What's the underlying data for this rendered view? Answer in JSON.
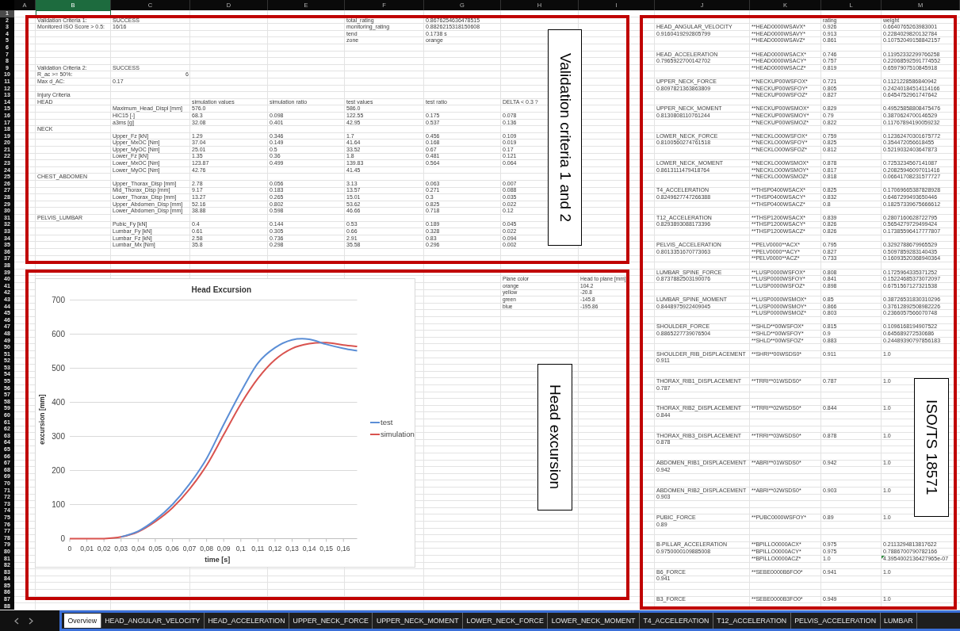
{
  "columns": [
    {
      "label": "A",
      "selected": false
    },
    {
      "label": "B",
      "selected": true
    },
    {
      "label": "C",
      "selected": false
    },
    {
      "label": "D",
      "selected": false
    },
    {
      "label": "E",
      "selected": false
    },
    {
      "label": "F",
      "selected": false
    },
    {
      "label": "G",
      "selected": false
    },
    {
      "label": "H",
      "selected": false
    },
    {
      "label": "I",
      "selected": false
    },
    {
      "label": "J",
      "selected": false
    },
    {
      "label": "K",
      "selected": false
    },
    {
      "label": "L",
      "selected": false
    },
    {
      "label": "M",
      "selected": false
    }
  ],
  "rows": [
    {
      "number": "1",
      "selected": true
    },
    {
      "number": "2",
      "selected": false,
      "cells": [
        null,
        "Validation Criteria 1:",
        "SUCCESS",
        null,
        null,
        "total_rating",
        "0.8676254636478515",
        null,
        null,
        null,
        null,
        "rating",
        "weight"
      ]
    },
    {
      "number": "3",
      "selected": false,
      "cells": [
        null,
        "Monitored ISO Score > 0.5:",
        "16/16",
        null,
        null,
        "monitoring_rating",
        "0.8826215318150608",
        null,
        null,
        "HEAD_ANGULAR_VELOCITY",
        "**HEAD0000WSAVX*",
        "0.926",
        "0.6640765263983001"
      ]
    },
    {
      "number": "4",
      "selected": false,
      "cells": [
        null,
        null,
        null,
        null,
        null,
        "tend",
        "0.1738 s",
        null,
        null,
        "0.9160419292805799",
        "**HEAD0000WSAVY*",
        "0.913",
        "0.2284029820132784"
      ]
    },
    {
      "number": "5",
      "selected": false,
      "cells": [
        null,
        null,
        null,
        null,
        null,
        "zone",
        "orange",
        null,
        null,
        null,
        "**HEAD0000WSAVZ*",
        "0.861",
        "0.10752049158842157"
      ]
    },
    {
      "number": "6",
      "selected": false
    },
    {
      "number": "7",
      "selected": false,
      "cells": [
        null,
        null,
        null,
        null,
        null,
        null,
        null,
        null,
        null,
        "HEAD_ACCELERATION",
        "**HEAD0000WSACX*",
        "0.746",
        "0.11952332299766258"
      ]
    },
    {
      "number": "8",
      "selected": false,
      "cells": [
        null,
        null,
        null,
        null,
        null,
        null,
        null,
        null,
        null,
        "0.7965922700142702",
        "**HEAD0000WSACY*",
        "0.757",
        "0.22068592591774552"
      ]
    },
    {
      "number": "9",
      "selected": false,
      "cells": [
        null,
        "Validation Criteria 2:",
        "SUCCESS",
        null,
        null,
        null,
        null,
        null,
        null,
        null,
        "**HEAD0000WSACZ*",
        "0.819",
        "0.6597907510845918"
      ]
    },
    {
      "number": "10",
      "selected": false,
      "cells": [
        null,
        "R_ac >= 50%:",
        {
          "text": "6",
          "kind": "number"
        }
      ]
    },
    {
      "number": "11",
      "selected": false,
      "cells": [
        null,
        "Max d_AC:",
        "0.17",
        null,
        null,
        null,
        null,
        null,
        null,
        "UPPER_NECK_FORCE",
        "**NECKUP00WSFOX*",
        "0.721",
        "0.1121228586840942"
      ]
    },
    {
      "number": "12",
      "selected": false,
      "cells": [
        null,
        null,
        null,
        null,
        null,
        null,
        null,
        null,
        null,
        "0.8097821363863809",
        "**NECKUP00WSFOY*",
        "0.805",
        "0.24240184514114166"
      ]
    },
    {
      "number": "13",
      "selected": false,
      "cells": [
        null,
        "Injury Criteria",
        null,
        null,
        null,
        null,
        null,
        null,
        null,
        null,
        "**NECKUP00WSFOZ*",
        "0.827",
        "0.6454752961747642"
      ]
    },
    {
      "number": "14",
      "selected": false,
      "cells": [
        null,
        "HEAD",
        null,
        "simulation values",
        "simulation ratio",
        "test values",
        "test ratio",
        "DELTA < 0.3 ?"
      ]
    },
    {
      "number": "15",
      "selected": false,
      "cells": [
        null,
        null,
        "Maximum_Head_Displ [mm]",
        "576.0",
        null,
        "586.0",
        null,
        null,
        null,
        "UPPER_NECK_MOMENT",
        "**NECKUP00WSMOX*",
        "0.829",
        "0.49525858808475476"
      ]
    },
    {
      "number": "16",
      "selected": false,
      "cells": [
        null,
        null,
        "HIC15 [-]",
        "68.3",
        "0.098",
        "122.55",
        "0.175",
        "0.078",
        null,
        "0.8130808110761244",
        "**NECKUP00WSMOY*",
        "0.79",
        "0.3870624700146529"
      ]
    },
    {
      "number": "17",
      "selected": false,
      "cells": [
        null,
        null,
        "a3ms [g]",
        "32.08",
        "0.401",
        "42.95",
        "0.537",
        "0.136",
        null,
        null,
        "**NECKUP00WSMOZ*",
        "0.822",
        "0.11767894190059232"
      ]
    },
    {
      "number": "18",
      "selected": false,
      "cells": [
        null,
        "NECK"
      ]
    },
    {
      "number": "19",
      "selected": false,
      "cells": [
        null,
        null,
        "Upper_Fz [kN]",
        "1.29",
        "0.346",
        "1.7",
        "0.456",
        "0.109",
        null,
        "LOWER_NECK_FORCE",
        "**NECKLO00WSFOX*",
        "0.759",
        "0.12362470301675772"
      ]
    },
    {
      "number": "20",
      "selected": false,
      "cells": [
        null,
        null,
        "Upper_MxOC [Nm]",
        "37.04",
        "0.149",
        "41.64",
        "0.168",
        "0.019",
        null,
        "0.8100560274761518",
        "**NECKLO00WSFOY*",
        "0.825",
        "0.354472056618455"
      ]
    },
    {
      "number": "21",
      "selected": false,
      "cells": [
        null,
        null,
        "Upper_MyOC [Nm]",
        "25.01",
        "0.5",
        "33.52",
        "0.67",
        "0.17",
        null,
        null,
        "**NECKLO00WSFOZ*",
        "0.812",
        "0.5219032403647873"
      ]
    },
    {
      "number": "22",
      "selected": false,
      "cells": [
        null,
        null,
        "Lower_Fz [kN]",
        "1.35",
        "0.36",
        "1.8",
        "0.481",
        "0.121"
      ]
    },
    {
      "number": "23",
      "selected": false,
      "cells": [
        null,
        null,
        "Lower_MxOC [Nm]",
        "123.87",
        "0.499",
        "139.83",
        "0.564",
        "0.064",
        null,
        "LOWER_NECK_MOMENT",
        "**NECKLO00WSMOX*",
        "0.878",
        "0.7253234567141087"
      ]
    },
    {
      "number": "24",
      "selected": false,
      "cells": [
        null,
        null,
        "Lower_MyOC [Nm]",
        "42.76",
        null,
        "41.45",
        null,
        null,
        null,
        "0.8613111479418764",
        "**NECKLO00WSMOY*",
        "0.817",
        "0.20825946097011416"
      ]
    },
    {
      "number": "25",
      "selected": false,
      "cells": [
        null,
        "CHEST_ABDOMEN",
        null,
        null,
        null,
        null,
        null,
        null,
        null,
        null,
        "**NECKLO00WSMOZ*",
        "0.818",
        "0.06641708231577727"
      ]
    },
    {
      "number": "26",
      "selected": false,
      "cells": [
        null,
        null,
        "Upper_Thorax_Disp [mm]",
        "2.78",
        "0.056",
        "3.13",
        "0.063",
        "0.007"
      ]
    },
    {
      "number": "27",
      "selected": false,
      "cells": [
        null,
        null,
        "Mid_Thorax_Disp [mm]",
        "9.17",
        "0.183",
        "13.57",
        "0.271",
        "0.088",
        null,
        "T4_ACCELERATION",
        "**THSP0400WSACX*",
        "0.825",
        "0.17069665387828928"
      ]
    },
    {
      "number": "28",
      "selected": false,
      "cells": [
        null,
        null,
        "Lower_Thorax_Disp [mm]",
        "13.27",
        "0.265",
        "15.01",
        "0.3",
        "0.035",
        null,
        "0.8249627747266388",
        "**THSP0400WSACY*",
        "0.832",
        "0.6467299493650446"
      ]
    },
    {
      "number": "29",
      "selected": false,
      "cells": [
        null,
        null,
        "Upper_Abdomen_Disp [mm]",
        "52.16",
        "0.802",
        "53.62",
        "0.825",
        "0.022",
        null,
        null,
        "**THSP0400WSACZ*",
        "0.8",
        "0.18257339675666612"
      ]
    },
    {
      "number": "30",
      "selected": false,
      "cells": [
        null,
        null,
        "Lower_Abdomen_Disp [mm]",
        "38.88",
        "0.598",
        "46.66",
        "0.718",
        "0.12"
      ]
    },
    {
      "number": "31",
      "selected": false,
      "cells": [
        null,
        "PELVIS_LUMBAR",
        null,
        null,
        null,
        null,
        null,
        null,
        null,
        "T12_ACCELERATION",
        "**THSP1200WSACX*",
        "0.839",
        "0.2807160628722795"
      ]
    },
    {
      "number": "32",
      "selected": false,
      "cells": [
        null,
        null,
        "Pubic_Fy [kN]",
        "0.4",
        "0.144",
        "0.53",
        "0.189",
        "0.045",
        null,
        "0.8293893088173396",
        "**THSP1200WSACY*",
        "0.826",
        "0.5654279729499424"
      ]
    },
    {
      "number": "33",
      "selected": false,
      "cells": [
        null,
        null,
        "Lumbar_Fy [kN]",
        "0.61",
        "0.305",
        "0.66",
        "0.328",
        "0.022",
        null,
        null,
        "**THSP1200WSACZ*",
        "0.826",
        "0.17385596417777807"
      ]
    },
    {
      "number": "34",
      "selected": false,
      "cells": [
        null,
        null,
        "Lumbar_Fz [kN]",
        "2.58",
        "0.736",
        "2.91",
        "0.83",
        "0.094"
      ]
    },
    {
      "number": "35",
      "selected": false,
      "cells": [
        null,
        null,
        "Lumbar_Mx [Nm]",
        "35.8",
        "0.298",
        "35.58",
        "0.296",
        "0.002",
        null,
        "PELVIS_ACCELERATION",
        "**PELV0000**ACX*",
        "0.795",
        "0.3292788679965529"
      ]
    },
    {
      "number": "36",
      "selected": false,
      "cells": [
        null,
        null,
        null,
        null,
        null,
        null,
        null,
        null,
        null,
        "0.8013351670773063",
        "**PELV0000**ACY*",
        "0.827",
        "0.5097859283140435"
      ]
    },
    {
      "number": "37",
      "selected": false,
      "cells": [
        null,
        null,
        null,
        null,
        null,
        null,
        null,
        null,
        null,
        null,
        "**PELV0000**ACZ*",
        "0.733",
        "0.16093520368940364"
      ]
    },
    {
      "number": "38",
      "selected": false
    },
    {
      "number": "39",
      "selected": false,
      "cells": [
        null,
        null,
        null,
        null,
        null,
        null,
        null,
        null,
        null,
        "LUMBAR_SPINE_FORCE",
        "**LUSP0000WSFOX*",
        "0.808",
        "0.1725964335371252"
      ]
    },
    {
      "number": "40",
      "selected": false,
      "cells": [
        null,
        null,
        null,
        null,
        null,
        null,
        null,
        {
          "text": "Plane color",
          "kind": "note"
        },
        {
          "text": "Head to plane [mm]",
          "kind": "note"
        },
        "0.8737882503190076",
        "**LUSP0000WSFOY*",
        "0.841",
        "0.15224685373072097"
      ]
    },
    {
      "number": "41",
      "selected": false,
      "cells": [
        null,
        null,
        null,
        null,
        null,
        null,
        null,
        {
          "text": "orange",
          "kind": "note"
        },
        {
          "text": "104.2",
          "kind": "note"
        },
        null,
        "**LUSP0000WSFOZ*",
        "0.898",
        "0.6751567127321538"
      ]
    },
    {
      "number": "42",
      "selected": false,
      "cells": [
        null,
        null,
        null,
        null,
        null,
        null,
        null,
        {
          "text": "yellow",
          "kind": "note"
        },
        {
          "text": "-20.8",
          "kind": "note"
        }
      ]
    },
    {
      "number": "43",
      "selected": false,
      "cells": [
        null,
        null,
        null,
        null,
        null,
        null,
        null,
        {
          "text": "green",
          "kind": "note"
        },
        {
          "text": "-145.8",
          "kind": "note"
        },
        "LUMBAR_SPINE_MOMENT",
        "**LUSP0000WSMOX*",
        "0.85",
        "0.38726531830310296"
      ]
    },
    {
      "number": "44",
      "selected": false,
      "cells": [
        null,
        null,
        null,
        null,
        null,
        null,
        null,
        {
          "text": "blue",
          "kind": "note"
        },
        {
          "text": "-195.86",
          "kind": "note"
        },
        "0.8448975922409045",
        "**LUSP0000WSMOY*",
        "0.866",
        "0.37612892508982226"
      ]
    },
    {
      "number": "45",
      "selected": false,
      "cells": [
        null,
        null,
        null,
        null,
        null,
        null,
        null,
        null,
        null,
        null,
        "**LUSP0000WSMOZ*",
        "0.803",
        "0.2366057566070748"
      ]
    },
    {
      "number": "46",
      "selected": false
    },
    {
      "number": "47",
      "selected": false,
      "cells": [
        null,
        null,
        null,
        null,
        null,
        null,
        null,
        null,
        null,
        "SHOULDER_FORCE",
        "**SHLD**00WSFOX*",
        "0.815",
        "0.1096168194907522"
      ]
    },
    {
      "number": "48",
      "selected": false,
      "cells": [
        null,
        null,
        null,
        null,
        null,
        null,
        null,
        null,
        null,
        "0.8865227739076504",
        "**SHLD**00WSFOY*",
        "0.9",
        "0.645689272530686"
      ]
    },
    {
      "number": "49",
      "selected": false,
      "cells": [
        null,
        null,
        null,
        null,
        null,
        null,
        null,
        null,
        null,
        null,
        "**SHLD**00WSFOZ*",
        "0.883",
        "0.24489390797856183"
      ]
    },
    {
      "number": "50",
      "selected": false
    },
    {
      "number": "51",
      "selected": false,
      "cells": [
        null,
        null,
        null,
        null,
        null,
        null,
        null,
        null,
        null,
        "SHOULDER_RIB_DISPLACEMENT",
        "**SHRI**00WSDS0*",
        "0.911",
        "1.0"
      ]
    },
    {
      "number": "52",
      "selected": false,
      "cells": [
        null,
        null,
        null,
        null,
        null,
        null,
        null,
        null,
        null,
        "0.911"
      ]
    },
    {
      "number": "53",
      "selected": false
    },
    {
      "number": "54",
      "selected": false
    },
    {
      "number": "55",
      "selected": false,
      "cells": [
        null,
        null,
        null,
        null,
        null,
        null,
        null,
        null,
        null,
        "THORAX_RIB1_DISPLACEMENT",
        "**TRRI**01WSDS0*",
        "0.787",
        "1.0"
      ]
    },
    {
      "number": "56",
      "selected": false,
      "cells": [
        null,
        null,
        null,
        null,
        null,
        null,
        null,
        null,
        null,
        "0.787"
      ]
    },
    {
      "number": "57",
      "selected": false
    },
    {
      "number": "58",
      "selected": false
    },
    {
      "number": "59",
      "selected": false,
      "cells": [
        null,
        null,
        null,
        null,
        null,
        null,
        null,
        null,
        null,
        "THORAX_RIB2_DISPLACEMENT",
        "**TRRI**02WSDS0*",
        "0.844",
        "1.0"
      ]
    },
    {
      "number": "60",
      "selected": false,
      "cells": [
        null,
        null,
        null,
        null,
        null,
        null,
        null,
        null,
        null,
        "0.844"
      ]
    },
    {
      "number": "61",
      "selected": false
    },
    {
      "number": "62",
      "selected": false
    },
    {
      "number": "63",
      "selected": false,
      "cells": [
        null,
        null,
        null,
        null,
        null,
        null,
        null,
        null,
        null,
        "THORAX_RIB3_DISPLACEMENT",
        "**TRRI**03WSDS0*",
        "0.878",
        "1.0"
      ]
    },
    {
      "number": "64",
      "selected": false,
      "cells": [
        null,
        null,
        null,
        null,
        null,
        null,
        null,
        null,
        null,
        "0.878"
      ]
    },
    {
      "number": "65",
      "selected": false
    },
    {
      "number": "66",
      "selected": false
    },
    {
      "number": "67",
      "selected": false,
      "cells": [
        null,
        null,
        null,
        null,
        null,
        null,
        null,
        null,
        null,
        "ABDOMEN_RIB1_DISPLACEMENT",
        "**ABRI**01WSDS0*",
        "0.942",
        "1.0"
      ]
    },
    {
      "number": "68",
      "selected": false,
      "cells": [
        null,
        null,
        null,
        null,
        null,
        null,
        null,
        null,
        null,
        "0.942"
      ]
    },
    {
      "number": "69",
      "selected": false
    },
    {
      "number": "70",
      "selected": false
    },
    {
      "number": "71",
      "selected": false,
      "cells": [
        null,
        null,
        null,
        null,
        null,
        null,
        null,
        null,
        null,
        "ABDOMEN_RIB2_DISPLACEMENT",
        "**ABRI**02WSDS0*",
        "0.903",
        "1.0"
      ]
    },
    {
      "number": "72",
      "selected": false,
      "cells": [
        null,
        null,
        null,
        null,
        null,
        null,
        null,
        null,
        null,
        "0.903"
      ]
    },
    {
      "number": "73",
      "selected": false
    },
    {
      "number": "74",
      "selected": false
    },
    {
      "number": "75",
      "selected": false,
      "cells": [
        null,
        null,
        null,
        null,
        null,
        null,
        null,
        null,
        null,
        "PUBIC_FORCE",
        "**PUBC0000WSFOY*",
        "0.89",
        "1.0"
      ]
    },
    {
      "number": "76",
      "selected": false,
      "cells": [
        null,
        null,
        null,
        null,
        null,
        null,
        null,
        null,
        null,
        "0.89"
      ]
    },
    {
      "number": "77",
      "selected": false
    },
    {
      "number": "78",
      "selected": false
    },
    {
      "number": "79",
      "selected": false,
      "cells": [
        null,
        null,
        null,
        null,
        null,
        null,
        null,
        null,
        null,
        "B-PILLAR_ACCELERATION",
        "**BPILLO0000ACX*",
        "0.975",
        "0.2113294813817622"
      ]
    },
    {
      "number": "80",
      "selected": false,
      "cells": [
        null,
        null,
        null,
        null,
        null,
        null,
        null,
        null,
        null,
        "0.9750000109885008",
        "**BPILLO0000ACY*",
        "0.975",
        "0.7886700790782166"
      ]
    },
    {
      "number": "81",
      "selected": false,
      "cells": [
        null,
        null,
        null,
        null,
        null,
        null,
        null,
        null,
        null,
        null,
        "**BPILLO0000ACZ*",
        "1.0",
        {
          "text": "4.3954002136427965e-07",
          "flag": true
        }
      ]
    },
    {
      "number": "82",
      "selected": false
    },
    {
      "number": "83",
      "selected": false,
      "cells": [
        null,
        null,
        null,
        null,
        null,
        null,
        null,
        null,
        null,
        "B6_FORCE",
        "**SEBE0000B6FO0*",
        "0.941",
        "1.0"
      ]
    },
    {
      "number": "84",
      "selected": false,
      "cells": [
        null,
        null,
        null,
        null,
        null,
        null,
        null,
        null,
        null,
        "0.941"
      ]
    },
    {
      "number": "85",
      "selected": false
    },
    {
      "number": "86",
      "selected": false
    },
    {
      "number": "87",
      "selected": false,
      "cells": [
        null,
        null,
        null,
        null,
        null,
        null,
        null,
        null,
        null,
        "B3_FORCE",
        "**SEBE0000B3FO0*",
        "0.949",
        "1.0"
      ]
    },
    {
      "number": "88",
      "selected": false
    }
  ],
  "annotations": [
    {
      "text": "Validation criteria 1 and 2"
    },
    {
      "text": "Head excursion"
    },
    {
      "text": "ISO/TS 18571"
    }
  ],
  "chart": {
    "chart_data": {
      "type": "line",
      "title": "Head Excursion",
      "xlabel": "time [s]",
      "ylabel": "excursion [mm]",
      "x": [
        0,
        0.01,
        0.02,
        0.03,
        0.04,
        0.05,
        0.06,
        0.07,
        0.08,
        0.09,
        0.1,
        0.11,
        0.12,
        0.13,
        0.14,
        0.15,
        0.16,
        0.168
      ],
      "series": [
        {
          "name": "test",
          "color": "#5b8ed6",
          "values": [
            null,
            null,
            null,
            5,
            22,
            55,
            100,
            160,
            235,
            335,
            430,
            515,
            560,
            583,
            585,
            570,
            558,
            551
          ]
        },
        {
          "name": "simulation",
          "color": "#d9534f",
          "values": [
            0,
            0,
            0,
            5,
            20,
            50,
            90,
            145,
            215,
            305,
            395,
            470,
            525,
            558,
            572,
            575,
            568,
            564
          ]
        }
      ],
      "xlim": [
        0,
        0.168
      ],
      "ylim": [
        0,
        700
      ],
      "xticks": [
        {
          "value": 0,
          "label": "0"
        },
        {
          "value": 0.01,
          "label": "0,01"
        },
        {
          "value": 0.02,
          "label": "0,02"
        },
        {
          "value": 0.03,
          "label": "0,03"
        },
        {
          "value": 0.04,
          "label": "0,04"
        },
        {
          "value": 0.05,
          "label": "0,05"
        },
        {
          "value": 0.06,
          "label": "0,06"
        },
        {
          "value": 0.07,
          "label": "0,07"
        },
        {
          "value": 0.08,
          "label": "0,08"
        },
        {
          "value": 0.09,
          "label": "0,09"
        },
        {
          "value": 0.1,
          "label": "0,1"
        },
        {
          "value": 0.11,
          "label": "0,11"
        },
        {
          "value": 0.12,
          "label": "0,12"
        },
        {
          "value": 0.13,
          "label": "0,13"
        },
        {
          "value": 0.14,
          "label": "0,14"
        },
        {
          "value": 0.15,
          "label": "0,15"
        },
        {
          "value": 0.16,
          "label": "0,16"
        }
      ],
      "yticks": [
        0,
        100,
        200,
        300,
        400,
        500,
        600,
        700
      ],
      "grid": true,
      "legend": true
    }
  },
  "sheet_tabs": [
    {
      "label": "Overview",
      "selected": true
    },
    {
      "label": "HEAD_ANGULAR_VELOCITY",
      "selected": false
    },
    {
      "label": "HEAD_ACCELERATION",
      "selected": false
    },
    {
      "label": "UPPER_NECK_FORCE",
      "selected": false
    },
    {
      "label": "UPPER_NECK_MOMENT",
      "selected": false
    },
    {
      "label": "LOWER_NECK_FORCE",
      "selected": false
    },
    {
      "label": "LOWER_NECK_MOMENT",
      "selected": false
    },
    {
      "label": "T4_ACCELERATION",
      "selected": false
    },
    {
      "label": "T12_ACCELERATION",
      "selected": false
    },
    {
      "label": "PELVIS_ACCELERATION",
      "selected": false
    },
    {
      "label": "LUMBAR",
      "selected": false
    }
  ]
}
